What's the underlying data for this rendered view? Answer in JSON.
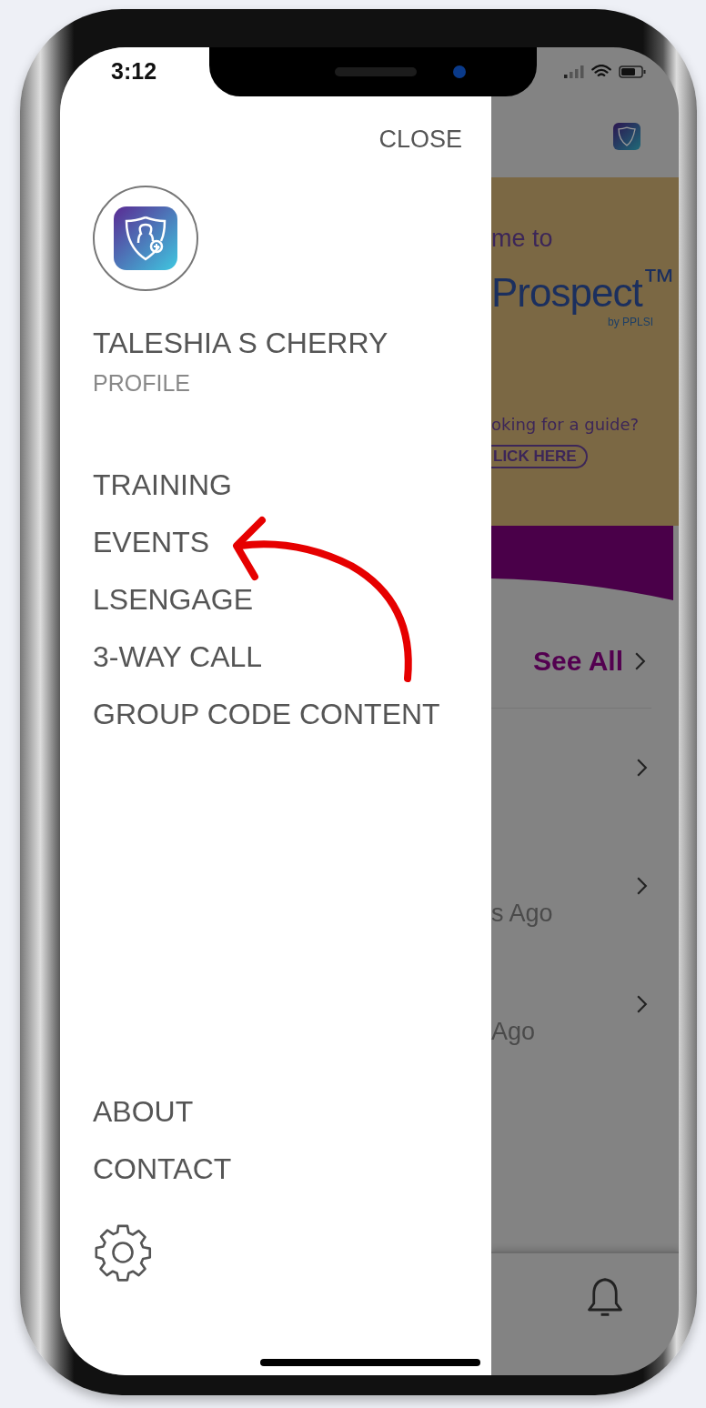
{
  "status_bar": {
    "time": "3:12"
  },
  "drawer": {
    "close": "CLOSE",
    "user_name": "TALESHIA S CHERRY",
    "profile_link": "PROFILE",
    "menu_items": [
      "TRAINING",
      "EVENTS",
      "LSENGAGE",
      "3-WAY CALL",
      "GROUP CODE CONTENT"
    ],
    "footer_items": [
      "ABOUT",
      "CONTACT"
    ]
  },
  "background_app": {
    "banner": {
      "welcome": "me to",
      "brand": "Prospect$^{™}$",
      "brand_sub": "by PPLSI",
      "question": "oking for a guide?",
      "button": "LICK HERE"
    },
    "see_all": "See All",
    "rows": [
      {
        "kind": "plain"
      },
      {
        "kind": "timed",
        "time": "s Ago"
      },
      {
        "kind": "timed",
        "time": "Ago"
      }
    ]
  }
}
